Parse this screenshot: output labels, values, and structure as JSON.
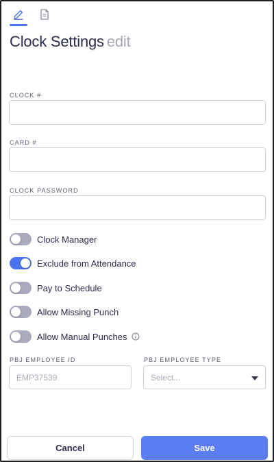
{
  "tabs": [
    {
      "icon": "pencil-icon",
      "active": true
    },
    {
      "icon": "document-icon",
      "active": false
    }
  ],
  "header": {
    "title": "Clock Settings",
    "edit_label": "edit"
  },
  "fields": {
    "clock_number": {
      "label": "CLOCK #",
      "value": ""
    },
    "card_number": {
      "label": "CARD #",
      "value": ""
    },
    "clock_password": {
      "label": "CLOCK PASSWORD",
      "value": ""
    }
  },
  "toggles": [
    {
      "label": "Clock Manager",
      "on": false
    },
    {
      "label": "Exclude from Attendance",
      "on": true
    },
    {
      "label": "Pay to Schedule",
      "on": false
    },
    {
      "label": "Allow Missing Punch",
      "on": false
    },
    {
      "label": "Allow Manual Punches",
      "on": false,
      "info_icon": "info-icon"
    }
  ],
  "pbj": {
    "employee_id": {
      "label": "PBJ EMPLOYEE ID",
      "placeholder": "EMP37539"
    },
    "employee_type": {
      "label": "PBJ EMPLOYEE TYPE",
      "placeholder": "Select..."
    }
  },
  "footer": {
    "cancel_label": "Cancel",
    "save_label": "Save"
  },
  "colors": {
    "accent": "#4a74ef",
    "save_button": "#5b7ef7",
    "toggle_off": "#a9aabd"
  }
}
